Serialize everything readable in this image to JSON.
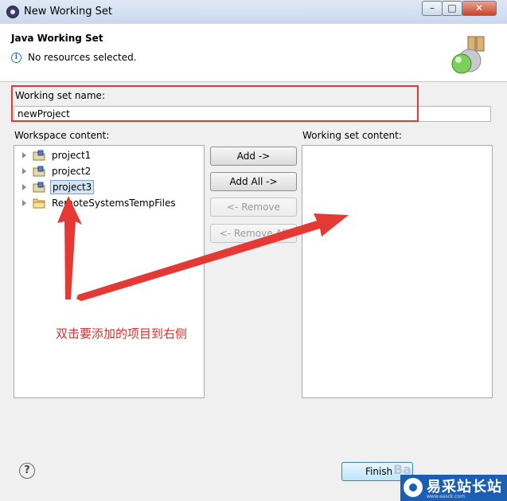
{
  "window": {
    "title": "New Working Set",
    "min_label": "–",
    "max_label": "□",
    "close_label": "✕"
  },
  "header": {
    "title": "Java Working Set",
    "message": "No resources selected.",
    "info_icon": "i"
  },
  "name_field": {
    "label": "Working set name:",
    "value": "newProject"
  },
  "workspace": {
    "label": "Workspace content:",
    "items": [
      {
        "label": "project1",
        "icon": "java-project-icon",
        "selected": false
      },
      {
        "label": "project2",
        "icon": "java-project-icon",
        "selected": false
      },
      {
        "label": "project3",
        "icon": "java-project-icon",
        "selected": true
      },
      {
        "label": "RemoteSystemsTempFiles",
        "icon": "folder-icon",
        "selected": false
      }
    ]
  },
  "buttons": {
    "add": "Add ->",
    "add_all": "Add All ->",
    "remove": "<- Remove",
    "remove_all": "<- Remove All"
  },
  "working_set_content": {
    "label": "Working set content:"
  },
  "annotation": {
    "text": "双击要添加的项目到右侧",
    "color": "#e53935"
  },
  "footer": {
    "help": "?",
    "finish": "Finish"
  },
  "watermark": {
    "text": "易采站长站",
    "sub": "www.easck.com",
    "ghost": "Ba"
  },
  "colors": {
    "accent": "#1a5fb4",
    "annotation": "#e53935",
    "selection": "#d3e4f7"
  }
}
